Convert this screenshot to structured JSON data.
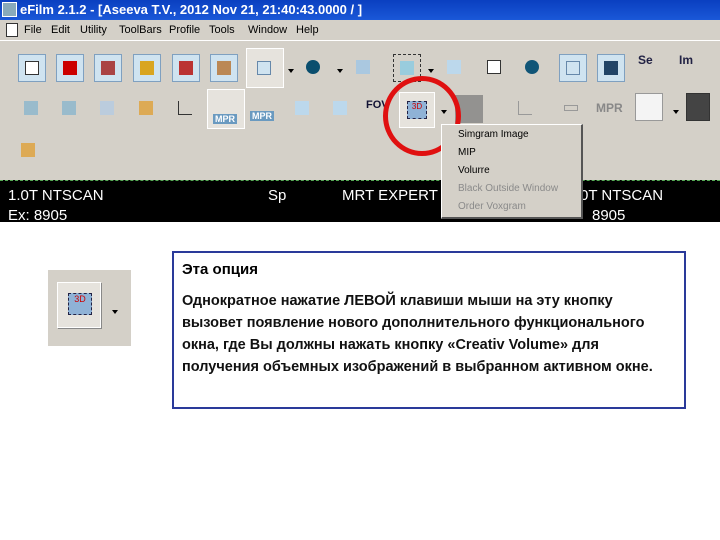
{
  "window": {
    "title": "eFilm 2.1.2 - [Aseeva T.V., 2012 Nov 21, 21:40:43.0000  /  ]"
  },
  "menu": [
    "File",
    "Edit",
    "Utility",
    "ToolBars",
    "Profile",
    "Tools",
    "Window",
    "Help"
  ],
  "toolbar": {
    "se_label": "Se",
    "im_label": "Im",
    "mpr_label": "MPR",
    "fov_label": "FOV",
    "threed_label": "3D"
  },
  "dropdown": {
    "items": [
      {
        "label": "Simgram Image",
        "enabled": true
      },
      {
        "label": "MIP",
        "enabled": true
      },
      {
        "label": "Volurre",
        "enabled": true
      },
      {
        "label": "Black Outside Window",
        "enabled": false
      },
      {
        "label": "Order Voxgram",
        "enabled": false
      }
    ]
  },
  "viewer": {
    "left_top": "1.0T NTSCAN",
    "left_bottom": "Ex: 8905",
    "mid1": "Sp",
    "mid2": "MRT EXPERT",
    "right_top": "0T NTSCAN",
    "right_bottom": "8905"
  },
  "callout": {
    "title": "Эта опция",
    "body": "Однократное нажатие ЛЕВОЙ клавиши мыши на эту кнопку вызовет появление нового дополнительного функционального окна, где Вы должны нажать кнопку «Creativ Volume» для получения объемных изображений в выбранном активном окне."
  },
  "colors": {
    "titlebar": "#0a3fc0",
    "highlight_circle": "#e01010",
    "callout_border": "#2a3a9a"
  }
}
